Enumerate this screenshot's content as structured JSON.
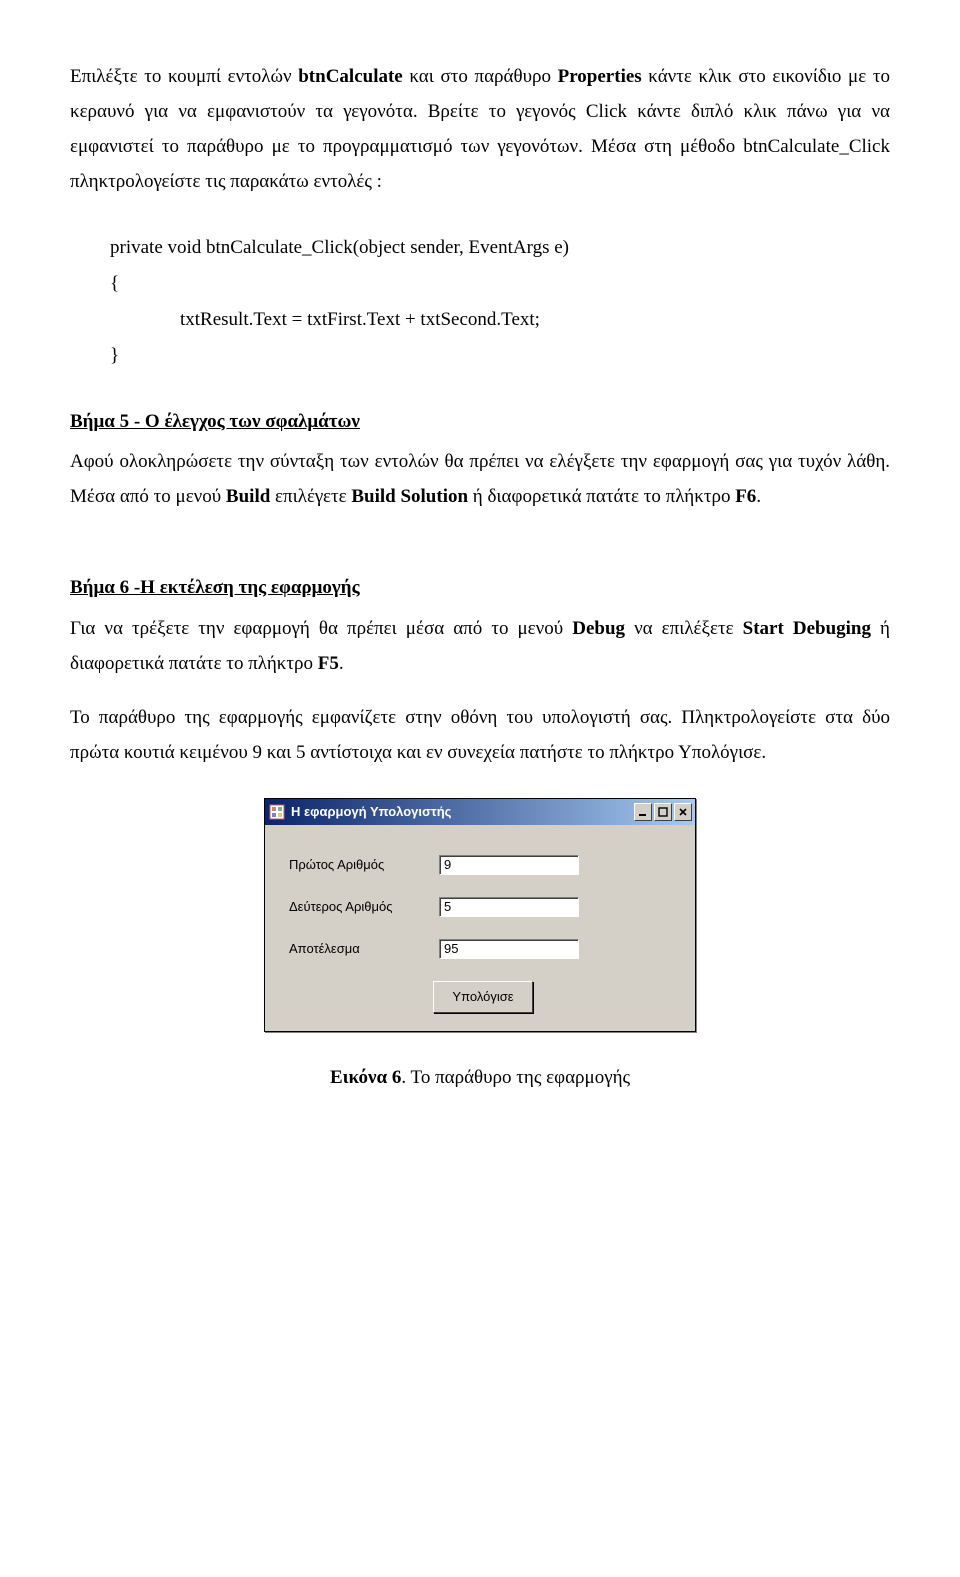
{
  "para1": {
    "t1": "Επιλέξτε το κουμπί εντολών ",
    "b1": "btnCalculate",
    "t2": " και στο παράθυρο ",
    "b2": "Properties",
    "t3": " κάντε κλικ στο εικονίδιο με το κεραυνό για να εμφανιστούν τα γεγονότα. Βρείτε το γεγονός Click κάντε διπλό κλικ πάνω για να εμφανιστεί το παράθυρο με το προγραμματισμό των γεγονότων. Μέσα στη μέθοδο btnCalculate_Click πληκτρολογείστε τις παρακάτω εντολές :"
  },
  "code": {
    "l1": "private void btnCalculate_Click(object sender, EventArgs e)",
    "l2": "{",
    "l3": "txtResult.Text = txtFirst.Text + txtSecond.Text;",
    "l4": "}"
  },
  "step5": {
    "head": "Βήμα 5 - Ο έλεγχος των σφαλμάτων",
    "t1": " Αφού ολοκληρώσετε την σύνταξη των εντολών θα πρέπει να ελέγξετε την εφαρμογή σας για τυχόν λάθη. Μέσα από το μενού ",
    "b1": "Build",
    "t2": " επιλέγετε ",
    "b2": "Build Solution",
    "t3": " ή διαφορετικά πατάτε το πλήκτρο ",
    "b3": "F6",
    "t4": "."
  },
  "step6": {
    "head": "Βήμα 6 -Η εκτέλεση της εφαρμογής",
    "t1": " Για να τρέξετε την εφαρμογή θα πρέπει μέσα από το μενού ",
    "b1": "Debug",
    "t2": " να επιλέξετε ",
    "b2": "Start Debuging",
    "t3": " ή διαφορετικά πατάτε το πλήκτρο ",
    "b3": "F5",
    "t4": ".",
    "t5": "Το παράθυρο της εφαρμογής εμφανίζετε στην οθόνη του υπολογιστή σας. Πληκτρολογείστε στα δύο πρώτα κουτιά κειμένου 9 και 5 αντίστοιχα και εν συνεχεία πατήστε το πλήκτρο Υπολόγισε."
  },
  "window": {
    "title": "Η εφαρμογή Υπολογιστής",
    "rows": [
      {
        "label": "Πρώτος Αριθμός",
        "value": "9"
      },
      {
        "label": "Δεύτερος Αριθμός",
        "value": "5"
      },
      {
        "label": "Αποτέλεσμα",
        "value": "95"
      }
    ],
    "button": "Υπολόγισε"
  },
  "caption": {
    "b": "Εικόνα 6",
    "t": ". Το παράθυρο της εφαρμογής"
  }
}
